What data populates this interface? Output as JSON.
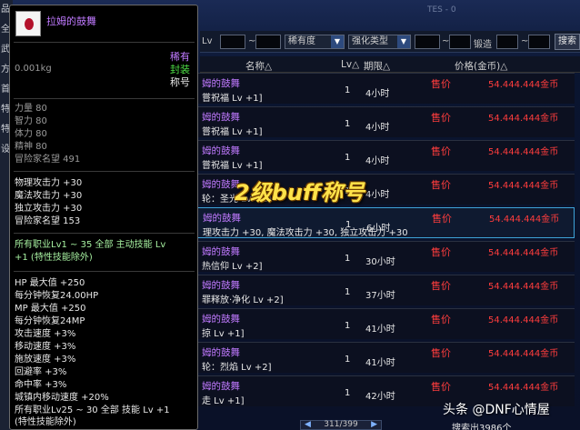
{
  "tooltip": {
    "title": "拉姆的鼓舞",
    "rarity": "稀有",
    "sealed": "封装",
    "type": "称号",
    "weight": "0.001kg",
    "stats1": [
      "力量 80",
      "智力 80",
      "体力 80",
      "精神 80",
      "冒险家名望 491"
    ],
    "stats2": [
      "物理攻击力 +30",
      "魔法攻击力 +30",
      "独立攻击力 +30",
      "冒险家名望 153"
    ],
    "skill1": [
      "所有职业Lv1 ~ 35 全部 主动技能 Lv",
      "+1 (特性技能除外)"
    ],
    "stats3": [
      "HP 最大值 +250",
      "每分钟恢复24.00HP",
      "MP 最大值 +250",
      "每分钟恢复24MP",
      "攻击速度 +3%",
      "移动速度 +3%",
      "施放速度 +3%",
      "回避率 +3%",
      "命中率 +3%",
      "城镇内移动速度 +20%"
    ],
    "skill2": [
      "所有职业Lv25 ~ 30 全部 技能 Lv +1",
      "(特性技能除外)"
    ]
  },
  "left_column": [
    "品",
    "全",
    "武",
    "方",
    "首",
    "特",
    "特",
    "设",
    "",
    "",
    "",
    "",
    "",
    "",
    "",
    "",
    "",
    "",
    "",
    ""
  ],
  "filter_bar": {
    "lv_label": "Lv",
    "tilde": "~",
    "rarity_select": "稀有度",
    "enhance_select": "强化类型",
    "forge_label": "锻造",
    "search_button": "搜索",
    "faint_text": "TES - 0"
  },
  "columns": {
    "name": "名称△",
    "lv": "Lv△",
    "period": "期限△",
    "price": "价格(金币)△"
  },
  "rows": [
    {
      "name": "姆的鼓舞",
      "sub": "嘗祝福 Lv +1]",
      "lv": "1",
      "period": "4小时",
      "sell": "售价",
      "price": "54.444.444金币",
      "selected": false
    },
    {
      "name": "姆的鼓舞",
      "sub": "嘗祝福 Lv +1]",
      "lv": "1",
      "period": "4小时",
      "sell": "售价",
      "price": "54.444.444金币",
      "selected": false
    },
    {
      "name": "姆的鼓舞",
      "sub": "嘗祝福 Lv +1]",
      "lv": "1",
      "period": "4小时",
      "sell": "售价",
      "price": "54.444.444金币",
      "selected": false
    },
    {
      "name": "姆的鼓舞",
      "sub": "轮：圣光 Lv +2]",
      "lv": "1",
      "period": "4小时",
      "sell": "售价",
      "price": "54.444.444金币",
      "selected": false
    },
    {
      "name": "姆的鼓舞",
      "sub": "理攻击力 +30, 魔法攻击力 +30, 独立攻击力 +30",
      "lv": "1",
      "period": "6小时",
      "sell": "售价",
      "price": "54.444.444金币",
      "selected": true
    },
    {
      "name": "姆的鼓舞",
      "sub": "热信仰 Lv +2]",
      "lv": "1",
      "period": "30小时",
      "sell": "售价",
      "price": "54.444.444金币",
      "selected": false
    },
    {
      "name": "姆的鼓舞",
      "sub": "罪释放·净化 Lv +2]",
      "lv": "1",
      "period": "37小时",
      "sell": "售价",
      "price": "54.444.444金币",
      "selected": false
    },
    {
      "name": "姆的鼓舞",
      "sub": "掠 Lv +1]",
      "lv": "1",
      "period": "41小时",
      "sell": "售价",
      "price": "54.444.444金币",
      "selected": false
    },
    {
      "name": "姆的鼓舞",
      "sub": "轮：烈焰 Lv +2]",
      "lv": "1",
      "period": "41小时",
      "sell": "售价",
      "price": "54.444.444金币",
      "selected": false
    },
    {
      "name": "姆的鼓舞",
      "sub": "走 Lv +1]",
      "lv": "1",
      "period": "42小时",
      "sell": "售价",
      "price": "54.444.444金币",
      "selected": false
    }
  ],
  "overlay_caption": "2级buff称号",
  "pager": {
    "text": "311/399",
    "prev": "◀",
    "next": "▶"
  },
  "watermark": "头条 @DNF心情屋",
  "search_count": "搜索出3986个"
}
